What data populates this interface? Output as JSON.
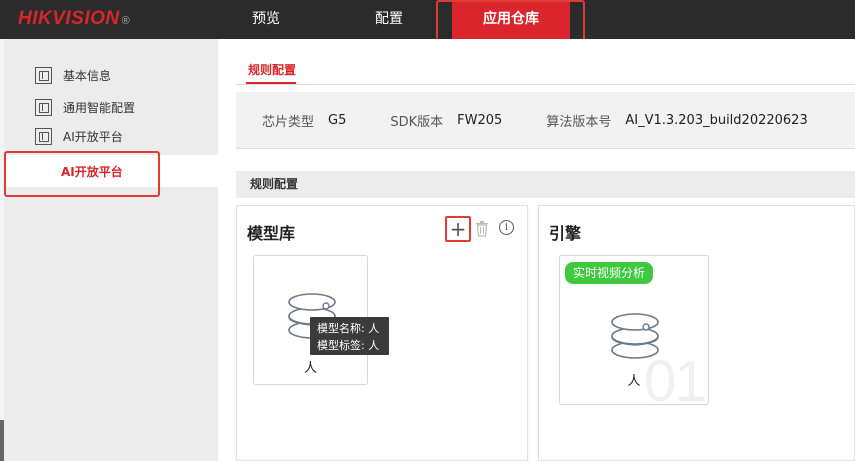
{
  "brand": {
    "logo_text": "HIKVISION",
    "reg_mark": "®",
    "accent": "#d9252b"
  },
  "topnav": {
    "items": [
      {
        "label": "预览"
      },
      {
        "label": "配置"
      },
      {
        "label": "应用仓库",
        "active": true
      }
    ]
  },
  "sidebar": {
    "items": [
      {
        "label": "基本信息",
        "icon": "grid-icon"
      },
      {
        "label": "通用智能配置",
        "icon": "grid-icon"
      },
      {
        "label": "AI开放平台",
        "icon": "grid-icon"
      }
    ],
    "active_label": "AI开放平台"
  },
  "main": {
    "tab": "规则配置",
    "info": {
      "chip_label": "芯片类型",
      "chip_value": "G5",
      "sdk_label": "SDK版本",
      "sdk_value": "FW205",
      "algo_label": "算法版本号",
      "algo_value": "AI_V1.3.203_build20220623"
    },
    "section_title": "规则配置",
    "model_panel": {
      "title": "模型库",
      "tools": [
        "plus-icon",
        "trash-icon",
        "info-icon"
      ],
      "info_glyph": "i",
      "add_glyph": "+",
      "card": {
        "name": "人",
        "icon": "database-icon"
      },
      "tooltip": {
        "name_line": "模型名称: 人",
        "tag_line": "模型标签: 人"
      }
    },
    "engine_panel": {
      "title": "引擎",
      "card": {
        "badge": "实时视频分析",
        "name": "人",
        "watermark": "01",
        "icon": "database-icon"
      }
    }
  }
}
